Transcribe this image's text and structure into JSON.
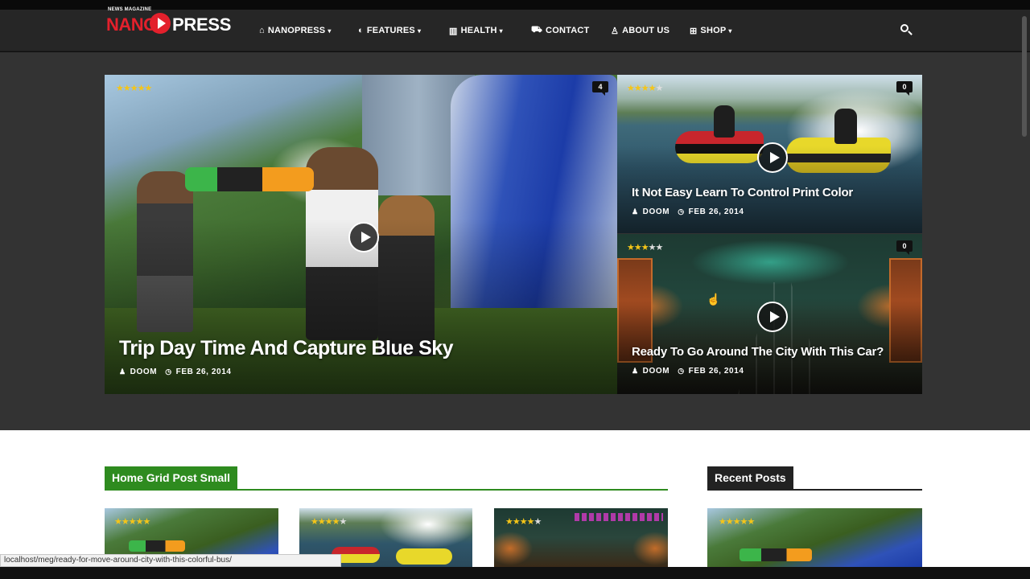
{
  "logo": {
    "tagline": "NEWS MAGAZINE",
    "part1": "NANO",
    "part2": "PRESS"
  },
  "nav": [
    {
      "label": "NANOPRESS",
      "icon": "home-icon",
      "glyph": "⌂",
      "dropdown": true
    },
    {
      "label": "FEATURES",
      "icon": "globe-icon",
      "glyph": "◐",
      "dropdown": true
    },
    {
      "label": "HEALTH",
      "icon": "bank-icon",
      "glyph": "▥",
      "dropdown": true
    },
    {
      "label": "CONTACT",
      "icon": "car-icon",
      "glyph": "⛟",
      "dropdown": false
    },
    {
      "label": "ABOUT US",
      "icon": "user-icon",
      "glyph": "♙",
      "dropdown": false
    },
    {
      "label": "SHOP",
      "icon": "basket-icon",
      "glyph": "⊞",
      "dropdown": true
    }
  ],
  "chevron": "▾",
  "hero": {
    "main": {
      "title": "Trip Day Time And Capture Blue Sky",
      "author": "DOOM",
      "date": "FEB 26, 2014",
      "comments": "4",
      "rating": 5
    },
    "top_right": {
      "title": "It Not Easy Learn To Control Print Color",
      "author": "DOOM",
      "date": "FEB 26, 2014",
      "comments": "0",
      "rating": 4
    },
    "bottom_right": {
      "title": "Ready To Go Around The City With This Car?",
      "author": "DOOM",
      "date": "FEB 26, 2014",
      "comments": "0",
      "rating": 3
    }
  },
  "sections": {
    "grid": {
      "title": "Home Grid Post Small",
      "color": "#2e8b1f"
    },
    "recent": {
      "title": "Recent Posts",
      "color": "#222222"
    }
  },
  "thumbs": [
    {
      "rating": 5
    },
    {
      "rating": 4
    },
    {
      "rating": 4
    },
    {
      "rating": 5
    }
  ],
  "status_url": "localhost/meg/ready-for-move-around-city-with-this-colorful-bus/",
  "colors": {
    "brand_red": "#e3202c",
    "star": "#f5c518"
  }
}
